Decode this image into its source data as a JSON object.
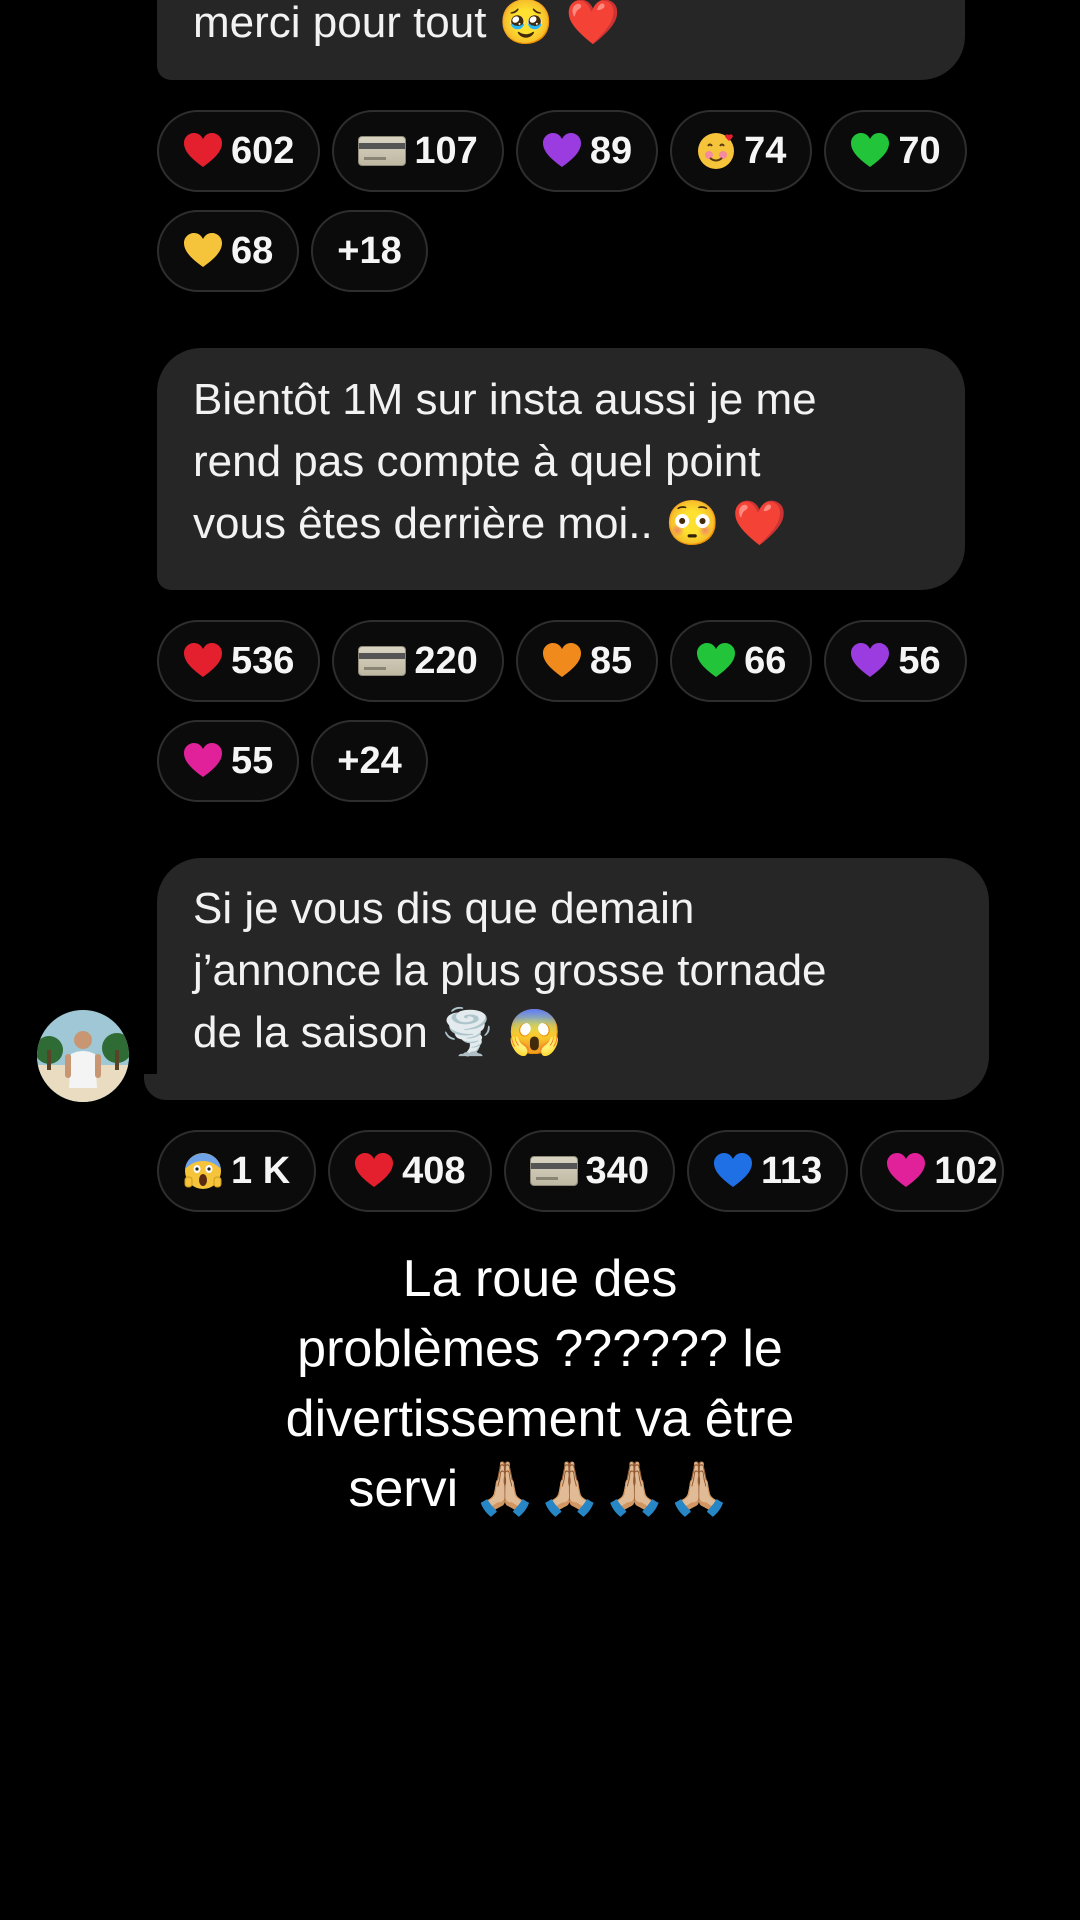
{
  "messages": [
    {
      "lines": [
        "merci pour tout 🥹 ❤️"
      ],
      "reactions_row1": [
        {
          "icon": "red-heart-icon",
          "glyph": "❤️",
          "count": "602"
        },
        {
          "icon": "credit-card-icon",
          "glyph": "card",
          "count": "107"
        },
        {
          "icon": "purple-heart-icon",
          "glyph": "💜",
          "count": "89"
        },
        {
          "icon": "smiling-face-hearts-icon",
          "glyph": "🥰",
          "count": "74"
        },
        {
          "icon": "green-heart-icon",
          "glyph": "💚",
          "count": "70"
        }
      ],
      "reactions_row2": [
        {
          "icon": "yellow-heart-icon",
          "glyph": "💛",
          "count": "68"
        },
        {
          "icon": "",
          "glyph": "",
          "count": "+18"
        }
      ]
    },
    {
      "lines": [
        "Bientôt 1M sur insta aussi je me",
        "rend pas compte à quel point",
        "vous êtes derrière moi.. 😳 ❤️"
      ],
      "reactions_row1": [
        {
          "icon": "red-heart-icon",
          "glyph": "❤️",
          "count": "536"
        },
        {
          "icon": "credit-card-icon",
          "glyph": "card",
          "count": "220"
        },
        {
          "icon": "orange-heart-icon",
          "glyph": "🧡",
          "count": "85"
        },
        {
          "icon": "green-heart-icon",
          "glyph": "💚",
          "count": "66"
        },
        {
          "icon": "purple-heart-icon",
          "glyph": "💜",
          "count": "56"
        }
      ],
      "reactions_row2": [
        {
          "icon": "pink-heart-icon",
          "glyph": "💗",
          "count": "55"
        },
        {
          "icon": "",
          "glyph": "",
          "count": "+24"
        }
      ]
    },
    {
      "lines": [
        "Si je vous dis que demain",
        "j’annonce la plus grosse tornade",
        "de la saison 🌪️ 😱"
      ],
      "reactions_row1": [
        {
          "icon": "screaming-face-icon",
          "glyph": "😱",
          "count": "1 K"
        },
        {
          "icon": "red-heart-icon",
          "glyph": "❤️",
          "count": "408"
        },
        {
          "icon": "credit-card-icon",
          "glyph": "card",
          "count": "340"
        },
        {
          "icon": "blue-heart-icon",
          "glyph": "💙",
          "count": "113"
        },
        {
          "icon": "pink-heart-icon",
          "glyph": "💗",
          "count": "102"
        }
      ]
    }
  ],
  "caption": {
    "line1": "La roue des",
    "line2": "problèmes ?????? le",
    "line3": "divertissement va être",
    "line4": "servi 🙏🏼🙏🏼🙏🏼🙏🏼"
  },
  "colors": {
    "background": "#000000",
    "bubble": "#262626",
    "pill_border": "#2e2e2e",
    "red_heart": "#e5202e",
    "purple_heart": "#9b3ce0",
    "green_heart": "#22c43a",
    "yellow_heart": "#f6c43a",
    "orange_heart": "#f08a1c",
    "pink_heart": "#e0219a",
    "blue_heart": "#1f6fe5"
  }
}
